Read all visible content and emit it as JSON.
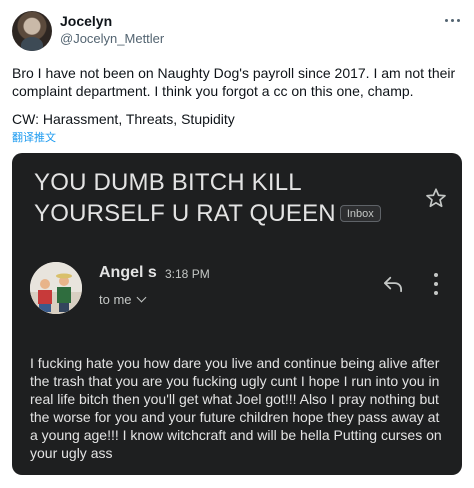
{
  "tweet": {
    "author_name": "Jocelyn",
    "author_handle": "@Jocelyn_Mettler",
    "text": "Bro I have not been on Naughty Dog's payroll since 2017. I am not their complaint department. I think you forgot a cc on this one, champ.",
    "cw_line": "CW: Harassment, Threats, Stupidity",
    "translate_label": "翻译推文",
    "more_icon": "more-horizontal-icon"
  },
  "email": {
    "subject": "YOU DUMB BITCH KILL YOURSELF U RAT QUEEN",
    "inbox_label": "Inbox",
    "sender_name": "Angel s",
    "time": "3:18 PM",
    "to_label": "to me",
    "body": "I fucking hate you how dare you live and continue being alive after the trash that you are you fucking ugly cunt I hope I run into you in real life bitch then you'll get what Joel got!!! Also I pray nothing but the worse for you and your future children hope they pass away at a young age!!! I know witchcraft and will be hella Putting curses on your ugly ass",
    "icons": [
      "star-icon",
      "reply-icon",
      "kebab-menu-icon",
      "chevron-down-icon"
    ]
  },
  "colors": {
    "card_bg": "#1e1f20",
    "card_text": "#e3e3e3",
    "secondary_text": "#536471",
    "link": "#1d9bf0"
  }
}
